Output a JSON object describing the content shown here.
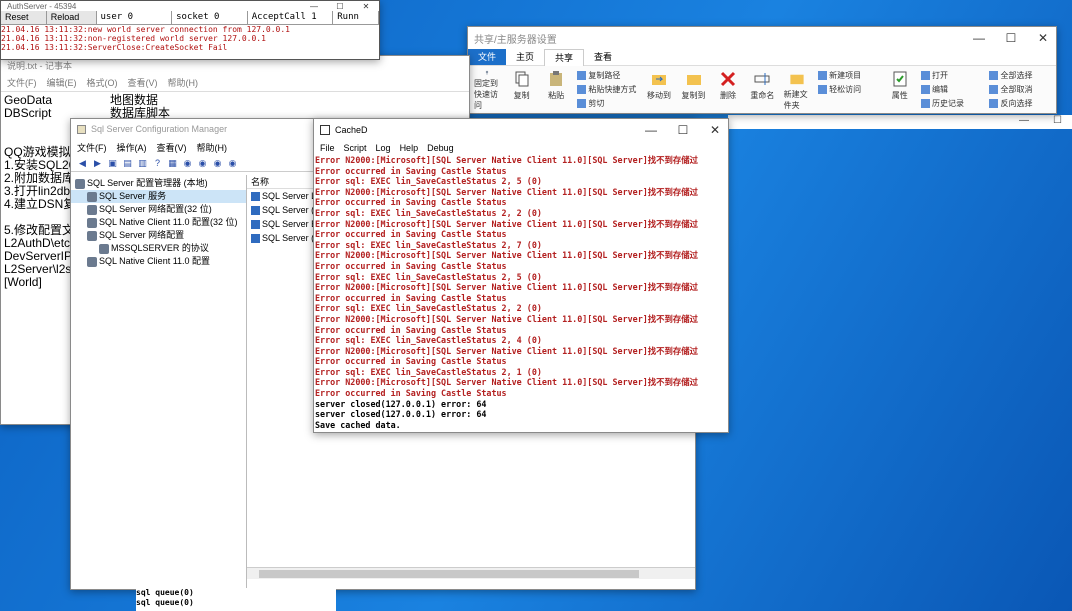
{
  "auth": {
    "title": "AuthServer - 45394",
    "buttons": [
      "Reset",
      "Reload"
    ],
    "stats": [
      "user 0",
      "socket 0",
      "AcceptCall 1",
      "Runn"
    ],
    "log": [
      "21.04.16 13:11:32:new world server connection from 127.0.0.1",
      "21.04.16 13:11:32:non-registered world server 127.0.0.1",
      "21.04.16 13:11:32:ServerClose:CreateSocket Fail"
    ]
  },
  "notepad": {
    "title": "说明.txt - 记事本",
    "menu": [
      "文件(F)",
      "编辑(E)",
      "格式(O)",
      "查看(V)",
      "帮助(H)"
    ],
    "lines": [
      {
        "a": "GeoData",
        "b": "地图数据"
      },
      {
        "a": "DBScript",
        "b": "数据库脚本"
      },
      {
        "a": "",
        "b": ""
      },
      {
        "a": "QQ游戏模拟器",
        "b": ""
      },
      {
        "a": "1.安装SQL201",
        "b": ""
      },
      {
        "a": "2.附加数据库",
        "b": ""
      },
      {
        "a": "3.打开lin2db.c",
        "b": ""
      },
      {
        "a": "4.建立DSN复制",
        "b": ""
      },
      {
        "a": "5.修改配置文件",
        "b": ""
      },
      {
        "a": "L2AuthD\\etc\\",
        "b": ""
      },
      {
        "a": "DevServerIP=",
        "b": ""
      },
      {
        "a": "L2Server\\l2se",
        "b": ""
      },
      {
        "a": "[World]",
        "b": ""
      }
    ]
  },
  "explorer": {
    "title": "共享/主服务器设置",
    "tabs": [
      "文件",
      "主页",
      "共享",
      "查看"
    ],
    "big_buttons": [
      "固定到快速访问",
      "复制",
      "粘贴",
      "移动到",
      "复制到",
      "删除",
      "重命名",
      "新建文件夹",
      "属性"
    ],
    "small_buttons": [
      "复制路径",
      "粘贴快捷方式",
      "剪切",
      "新建项目",
      "轻松访问",
      "打开",
      "编辑",
      "历史记录",
      "全部选择",
      "全部取消",
      "反向选择"
    ]
  },
  "sql": {
    "title": "Sql Server Configuration Manager",
    "menu": [
      "文件(F)",
      "操作(A)",
      "查看(V)",
      "帮助(H)"
    ],
    "tree": [
      {
        "label": "SQL Server 配置管理器 (本地)",
        "indent": 0
      },
      {
        "label": "SQL Server 服务",
        "indent": 1,
        "selected": true
      },
      {
        "label": "SQL Server 网络配置(32 位)",
        "indent": 1
      },
      {
        "label": "SQL Native Client 11.0 配置(32 位)",
        "indent": 1
      },
      {
        "label": "SQL Server 网络配置",
        "indent": 1
      },
      {
        "label": "MSSQLSERVER 的协议",
        "indent": 2
      },
      {
        "label": "SQL Native Client 11.0 配置",
        "indent": 1
      }
    ],
    "list_header": "名称",
    "list": [
      "SQL Server La",
      "SQL Server (M",
      "SQL Server B",
      "SQL Server (M"
    ]
  },
  "cached": {
    "title": "CacheD",
    "menu": [
      "File",
      "Script",
      "Log",
      "Help",
      "Debug"
    ],
    "log": [
      {
        "t": "Error N2000:[Microsoft][SQL Server Native Client 11.0][SQL Server]找不到存储过",
        "k": "err"
      },
      {
        "t": "Error occurred in Saving Castle Status",
        "k": "err"
      },
      {
        "t": "Error sql: EXEC lin_SaveCastleStatus 2, 5 (0)",
        "k": "err"
      },
      {
        "t": "Error N2000:[Microsoft][SQL Server Native Client 11.0][SQL Server]找不到存储过",
        "k": "err"
      },
      {
        "t": "Error occurred in Saving Castle Status",
        "k": "err"
      },
      {
        "t": "Error sql: EXEC lin_SaveCastleStatus 2, 2 (0)",
        "k": "err"
      },
      {
        "t": "Error N2000:[Microsoft][SQL Server Native Client 11.0][SQL Server]找不到存储过",
        "k": "err"
      },
      {
        "t": "Error occurred in Saving Castle Status",
        "k": "err"
      },
      {
        "t": "Error sql: EXEC lin_SaveCastleStatus 2, 7 (0)",
        "k": "err"
      },
      {
        "t": "Error N2000:[Microsoft][SQL Server Native Client 11.0][SQL Server]找不到存储过",
        "k": "err"
      },
      {
        "t": "Error occurred in Saving Castle Status",
        "k": "err"
      },
      {
        "t": "Error sql: EXEC lin_SaveCastleStatus 2, 5 (0)",
        "k": "err"
      },
      {
        "t": "Error N2000:[Microsoft][SQL Server Native Client 11.0][SQL Server]找不到存储过",
        "k": "err"
      },
      {
        "t": "Error occurred in Saving Castle Status",
        "k": "err"
      },
      {
        "t": "Error sql: EXEC lin_SaveCastleStatus 2, 2 (0)",
        "k": "err"
      },
      {
        "t": "Error N2000:[Microsoft][SQL Server Native Client 11.0][SQL Server]找不到存储过",
        "k": "err"
      },
      {
        "t": "Error occurred in Saving Castle Status",
        "k": "err"
      },
      {
        "t": "Error sql: EXEC lin_SaveCastleStatus 2, 4 (0)",
        "k": "err"
      },
      {
        "t": "Error N2000:[Microsoft][SQL Server Native Client 11.0][SQL Server]找不到存储过",
        "k": "err"
      },
      {
        "t": "Error occurred in Saving Castle Status",
        "k": "err"
      },
      {
        "t": "Error sql: EXEC lin_SaveCastleStatus 2, 1 (0)",
        "k": "err"
      },
      {
        "t": "Error N2000:[Microsoft][SQL Server Native Client 11.0][SQL Server]找不到存储过",
        "k": "err"
      },
      {
        "t": "Error occurred in Saving Castle Status",
        "k": "err"
      },
      {
        "t": "server closed(127.0.0.1) error: 64",
        "k": "ok"
      },
      {
        "t": "server closed(127.0.0.1) error: 64",
        "k": "ok"
      },
      {
        "t": "Save cached data.",
        "k": "ok"
      }
    ]
  },
  "console": {
    "lines": [
      "sql queue(0)",
      "sql queue(0)"
    ]
  },
  "colors": {
    "error": "#b32020",
    "desktop": "#0b5fc0",
    "file_tab": "#1c6fc9",
    "selection": "#cce4f7"
  }
}
